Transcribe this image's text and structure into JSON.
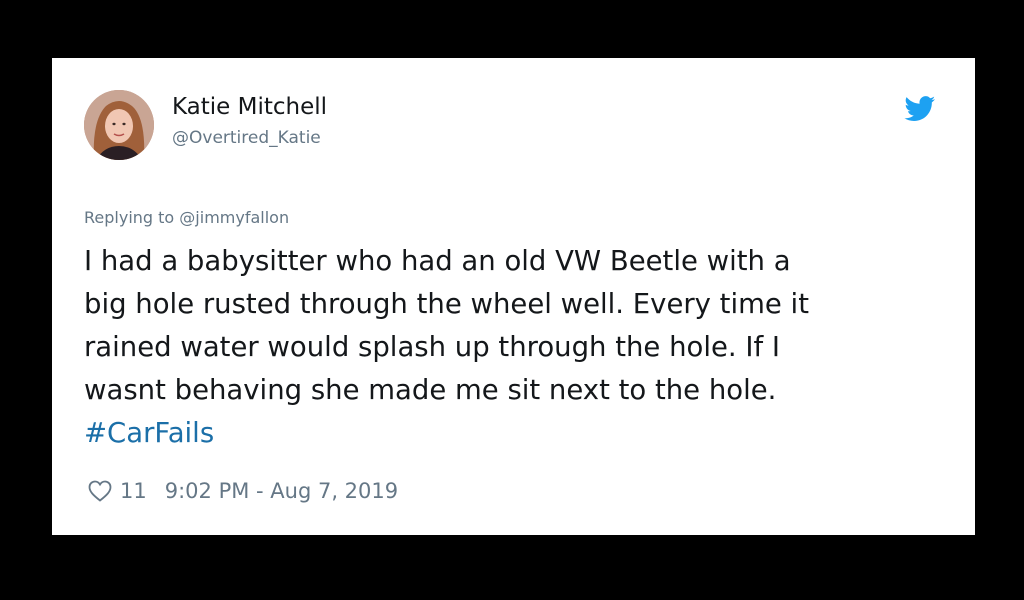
{
  "tweet": {
    "author": {
      "display_name": "Katie Mitchell",
      "handle": "@Overtired_Katie"
    },
    "brand_icon": "twitter-bird-icon",
    "reply_prefix": "Replying to",
    "reply_to": "@jimmyfallon",
    "text_lines": [
      "I had a babysitter who had an old VW Beetle with a",
      "big hole rusted through the wheel well. Every time it",
      "rained water would splash up through the hole. If I",
      "wasnt behaving she made me sit next to the hole."
    ],
    "hashtag": "#CarFails",
    "like_icon": "heart-icon",
    "like_count": "11",
    "timestamp": "9:02 PM - Aug 7, 2019"
  },
  "colors": {
    "background": "#000000",
    "card": "#ffffff",
    "text": "#14171a",
    "muted": "#657786",
    "hashtag": "#1b6fa8",
    "twitter_blue": "#1da1f2"
  }
}
